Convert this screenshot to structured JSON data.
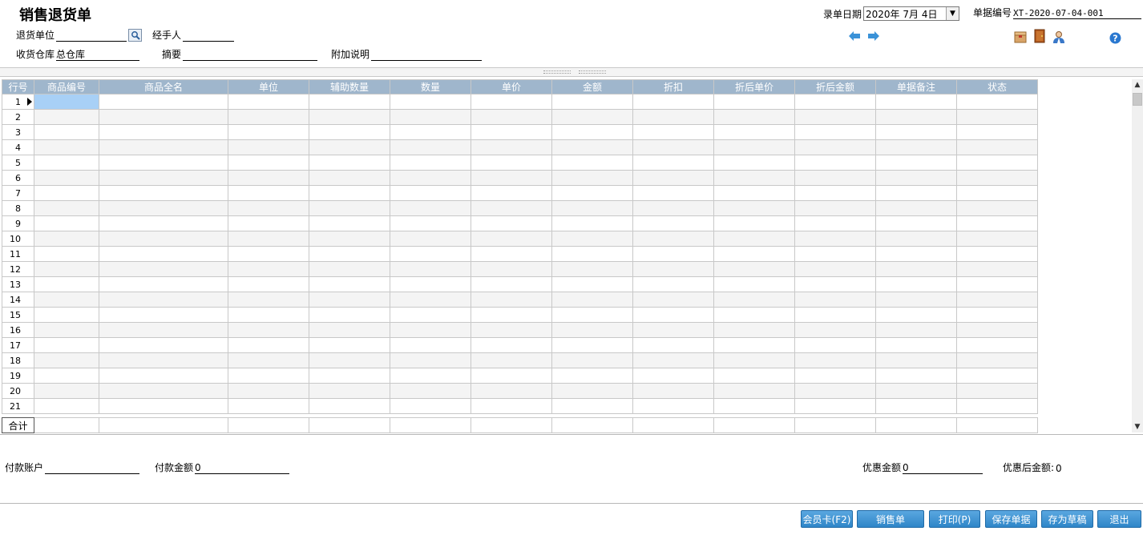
{
  "title": "销售退货单",
  "header": {
    "return_unit_label": "退货单位",
    "return_unit_value": "",
    "handler_label": "经手人",
    "handler_value": "",
    "warehouse_label": "收货仓库",
    "warehouse_value": "总仓库",
    "summary_label": "摘要",
    "summary_value": "",
    "note_label": "附加说明",
    "note_value": "",
    "date_label": "录单日期",
    "date_value": "2020年 7月 4日",
    "doc_no_label": "单据编号",
    "doc_no_value": "XT-2020-07-04-001"
  },
  "toolbar_icons": {
    "prev": "arrow-left-icon",
    "next": "arrow-right-icon",
    "box": "box-icon",
    "door": "door-icon",
    "user": "user-icon",
    "help": "help-icon"
  },
  "grid": {
    "columns": [
      "行号",
      "商品编号",
      "商品全名",
      "单位",
      "辅助数量",
      "数量",
      "单价",
      "金额",
      "折扣",
      "折后单价",
      "折后金额",
      "单据备注",
      "状态"
    ],
    "rows": [
      "1",
      "2",
      "3",
      "4",
      "5",
      "6",
      "7",
      "8",
      "9",
      "10",
      "11",
      "12",
      "13",
      "14",
      "15",
      "16",
      "17",
      "18",
      "19",
      "20",
      "21"
    ],
    "total_label": "合计"
  },
  "footer": {
    "pay_account_label": "付款账户",
    "pay_account_value": "",
    "pay_amount_label": "付款金额",
    "pay_amount_value": "0",
    "discount_label": "优惠金额",
    "discount_value": "0",
    "after_discount_label": "优惠后金额:",
    "after_discount_value": "0"
  },
  "buttons": {
    "member_card": "会员卡(F2)",
    "sales_order": "销售单",
    "print": "打印(P)",
    "save": "保存单据",
    "draft": "存为草稿",
    "exit": "退出"
  },
  "colors": {
    "header_bg": "#9fb6cc",
    "selected_cell": "#a8d0f6",
    "button": "#2f86c8"
  }
}
